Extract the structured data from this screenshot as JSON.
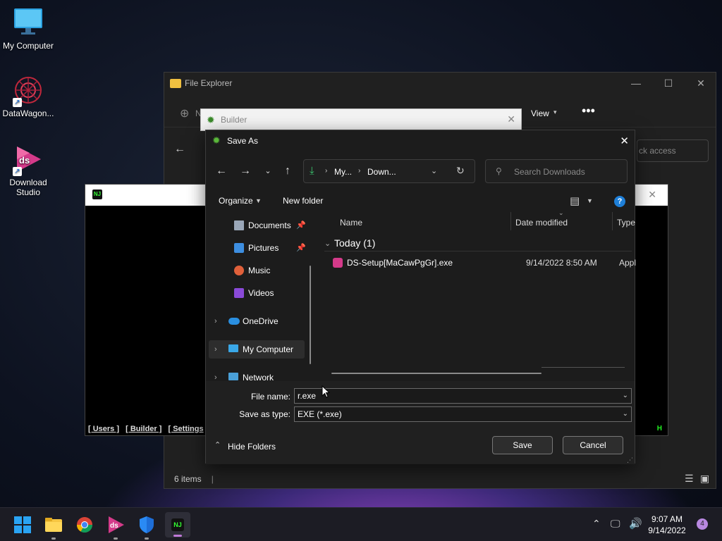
{
  "desktop": {
    "icons": [
      {
        "label": "My Computer"
      },
      {
        "label": "DataWagon..."
      },
      {
        "label": "Download Studio"
      }
    ]
  },
  "explorer": {
    "title": "File Explorer",
    "toolbar_new": "N",
    "toolbar_view": "View",
    "address_partial": "ck access",
    "status": "6 items"
  },
  "terminal": {
    "menu": [
      "[ Users ]",
      "[ Builder ]",
      "[ Settings"
    ],
    "right_char": "H"
  },
  "builder": {
    "title": "Builder"
  },
  "dialog": {
    "title": "Save As",
    "breadcrumb": [
      "My...",
      "Down..."
    ],
    "search_placeholder": "Search Downloads",
    "organize": "Organize",
    "new_folder": "New folder",
    "tree": [
      {
        "label": "Documents",
        "pinned": true
      },
      {
        "label": "Pictures",
        "pinned": true
      },
      {
        "label": "Music"
      },
      {
        "label": "Videos"
      },
      {
        "label": "OneDrive"
      },
      {
        "label": "My Computer"
      },
      {
        "label": "Network"
      }
    ],
    "columns": {
      "name": "Name",
      "date": "Date modified",
      "type": "Type"
    },
    "group": "Today (1)",
    "files": [
      {
        "name": "DS-Setup[MaCawPgGr].exe",
        "date": "9/14/2022 8:50 AM",
        "type": "Appli"
      }
    ],
    "file_name_label": "File name:",
    "file_name_value": "r.exe",
    "save_type_label": "Save as type:",
    "save_type_value": "EXE (*.exe)",
    "hide_folders": "Hide Folders",
    "save": "Save",
    "cancel": "Cancel"
  },
  "taskbar": {
    "time": "9:07 AM",
    "date": "9/14/2022",
    "notifications": "4"
  }
}
